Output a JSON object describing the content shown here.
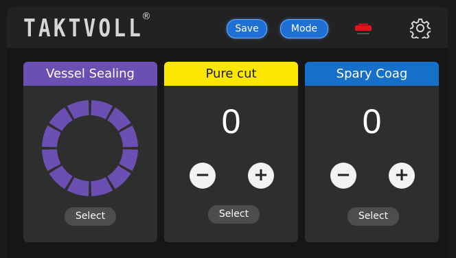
{
  "brand": {
    "name": "TAKTVOLL",
    "reg": "®"
  },
  "toolbar": {
    "save_label": "Save",
    "mode_label": "Mode"
  },
  "icons": {
    "status": "red-plug-icon",
    "settings": "gear-icon"
  },
  "colors": {
    "accent_blue": "#1e70d4",
    "vessel_purple": "#6b4fb3",
    "purecut_yellow": "#fbe702",
    "coag_blue": "#1670c9",
    "status_red": "#e0141e"
  },
  "panels": [
    {
      "title": "Vessel Sealing",
      "select_label": "Select",
      "ring_segments": 12
    },
    {
      "title": "Pure cut",
      "value": "0",
      "minus_label": "−",
      "plus_label": "+",
      "select_label": "Select"
    },
    {
      "title": "Spary Coag",
      "value": "0",
      "minus_label": "−",
      "plus_label": "+",
      "select_label": "Select"
    }
  ]
}
